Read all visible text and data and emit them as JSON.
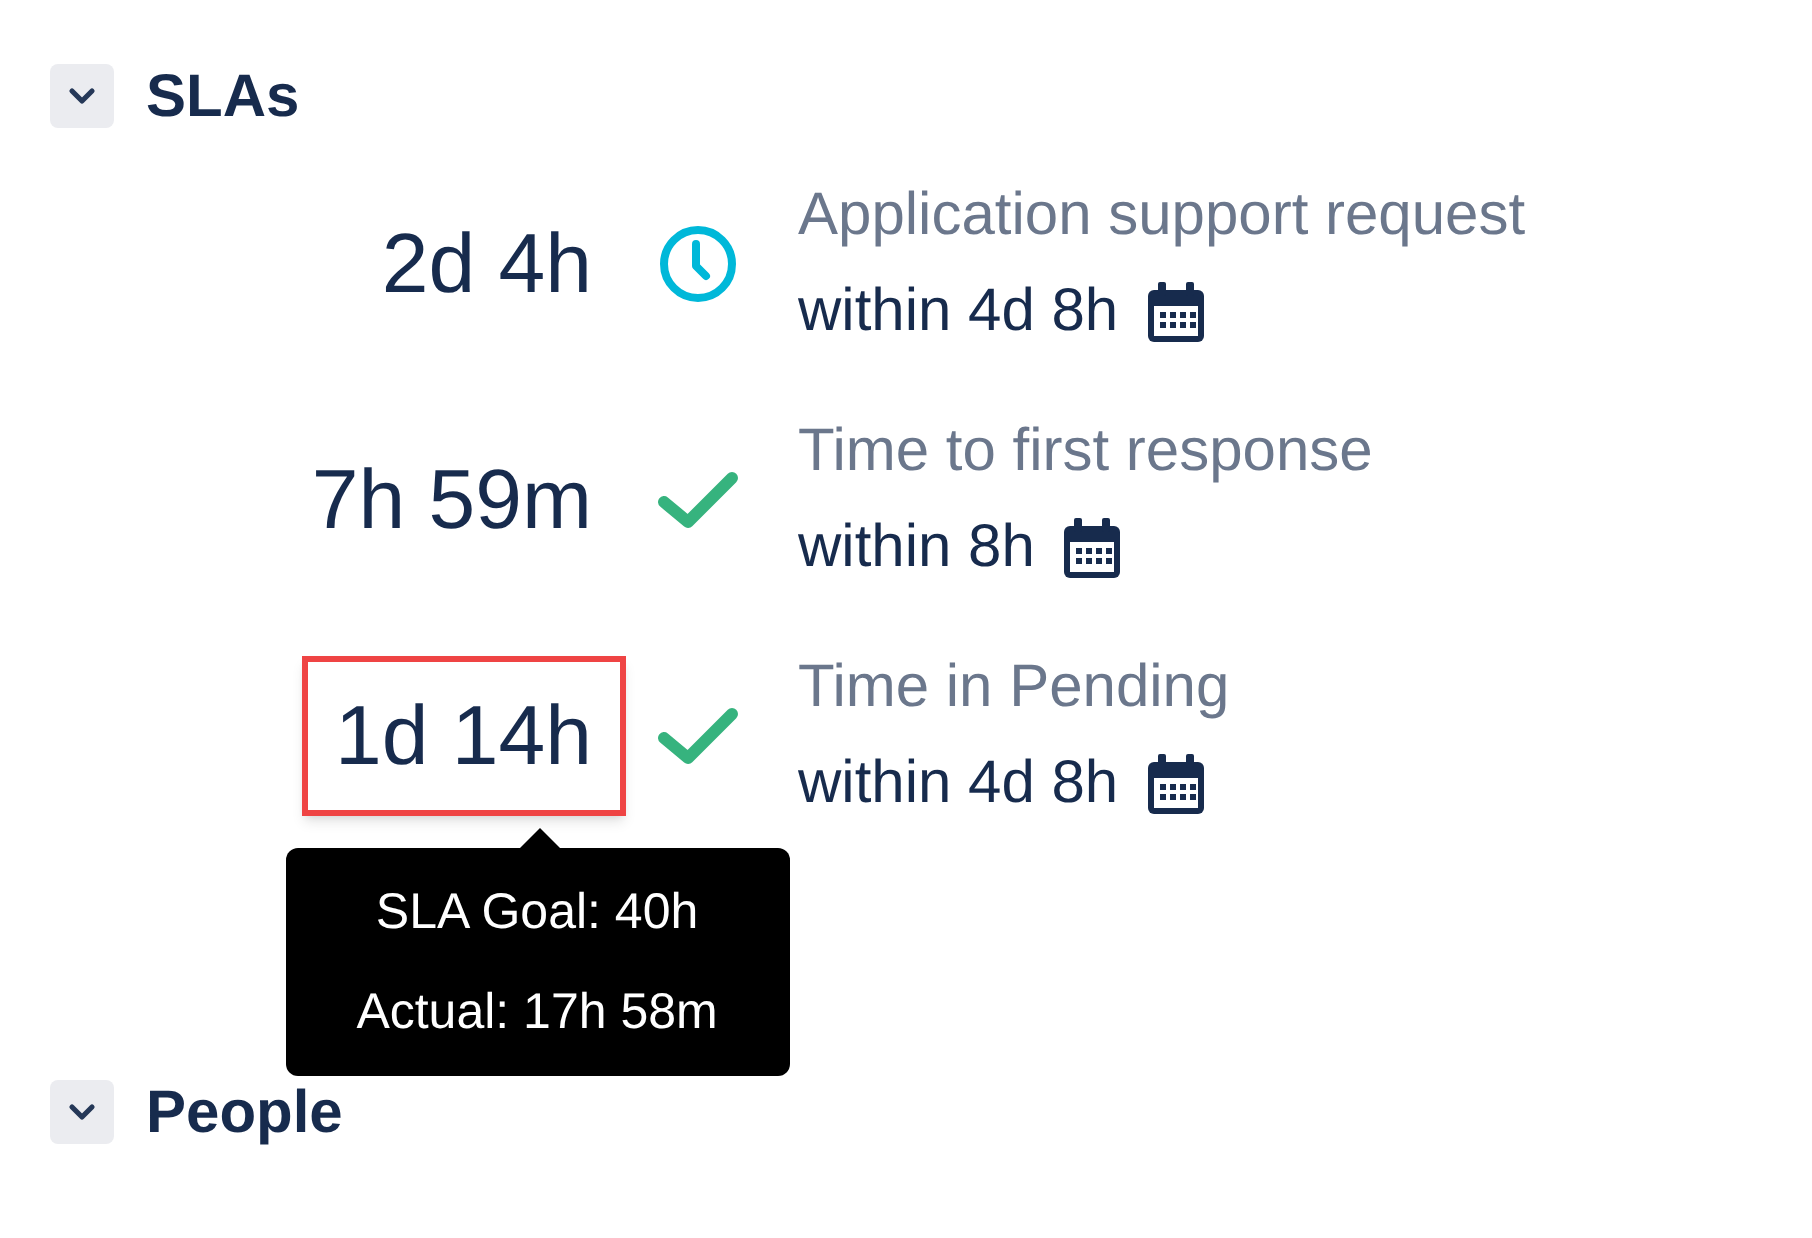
{
  "sections": [
    {
      "title": "SLAs",
      "expanded": true,
      "slas": [
        {
          "remaining": "2d 4h",
          "kind": "running",
          "name": "Application support request",
          "goal": "within 4d 8h",
          "highlighted": false
        },
        {
          "remaining": "7h 59m",
          "kind": "met",
          "name": "Time to first response",
          "goal": "within 8h",
          "highlighted": false
        },
        {
          "remaining": "1d 14h",
          "kind": "met",
          "name": "Time in Pending",
          "goal": "within 4d 8h",
          "highlighted": true,
          "tooltip": [
            "SLA Goal: 40h",
            "Actual: 17h 58m"
          ]
        }
      ]
    },
    {
      "title": "People",
      "expanded": true
    }
  ]
}
